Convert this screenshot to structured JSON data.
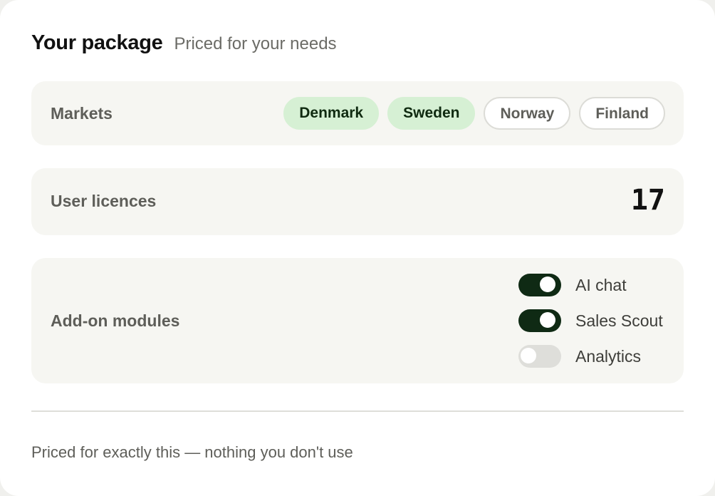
{
  "header": {
    "title": "Your package",
    "subtitle": "Priced for your needs"
  },
  "markets": {
    "label": "Markets",
    "options": [
      {
        "label": "Denmark",
        "selected": true
      },
      {
        "label": "Sweden",
        "selected": true
      },
      {
        "label": "Norway",
        "selected": false
      },
      {
        "label": "Finland",
        "selected": false
      }
    ]
  },
  "licences": {
    "label": "User licences",
    "count": "17"
  },
  "addons": {
    "label": "Add-on modules",
    "modules": [
      {
        "label": "AI chat",
        "enabled": true
      },
      {
        "label": "Sales Scout",
        "enabled": true
      },
      {
        "label": "Analytics",
        "enabled": false
      }
    ]
  },
  "footer": {
    "note": "Priced for exactly this — nothing you don't use"
  },
  "colors": {
    "selected_chip_bg": "#d6f0d4",
    "toggle_on": "#0f2a14",
    "toggle_off": "#dededa"
  }
}
